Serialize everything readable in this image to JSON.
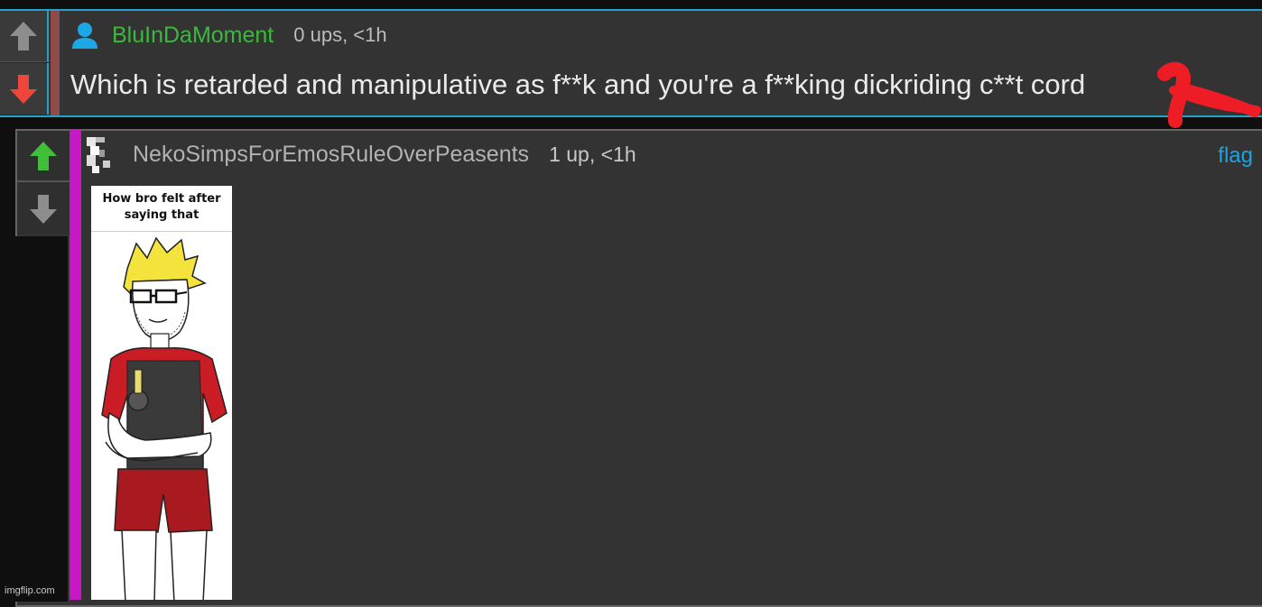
{
  "comment": {
    "username": "BluInDaMoment",
    "meta": "0 ups, <1h",
    "text": "Which is retarded and manipulative as f**k and you're a f**king dickriding c**t cord"
  },
  "reply": {
    "username": "NekoSimpsForEmosRuleOverPeasents",
    "meta": "1 up, <1h",
    "flag_label": "flag",
    "image_caption": "How bro felt after saying that"
  },
  "watermark": "imgflip.com",
  "colors": {
    "accent_blue": "#23a3c8",
    "username_green": "#3cb93c",
    "upvote_green": "#3fbe3a",
    "downvote_red": "#f0453a",
    "flag_blue": "#1fa3e0",
    "reply_bar_magenta": "#c718c7"
  },
  "icons": {
    "user": "user-icon",
    "upvote": "arrow-up-icon",
    "downvote": "arrow-down-icon"
  }
}
